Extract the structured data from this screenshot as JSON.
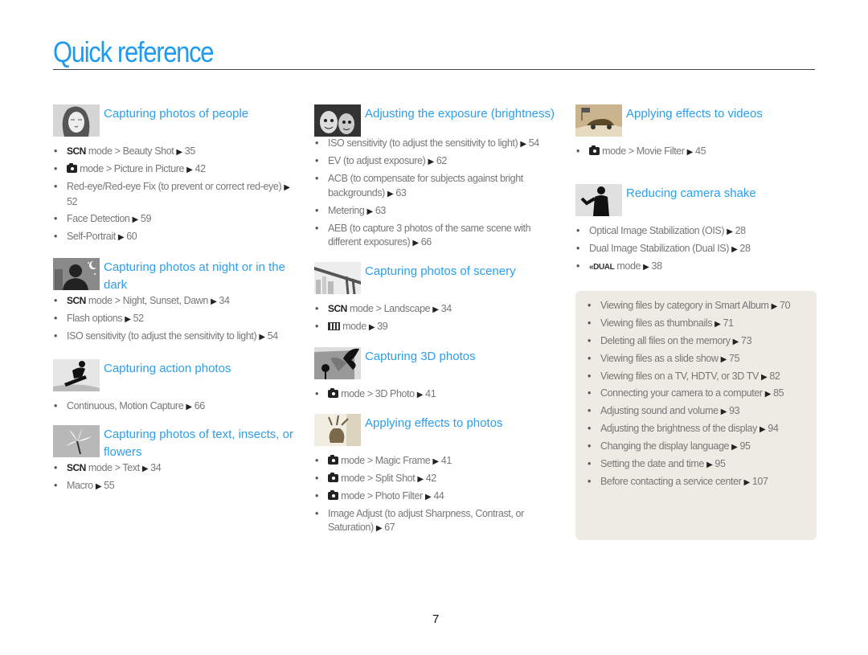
{
  "page": {
    "title": "Quick reference",
    "page_number": "7"
  },
  "columns": [
    {
      "sections": [
        {
          "title": "Capturing photos of people",
          "icon": "portrait-woman-thumbnail",
          "items": [
            {
              "prefix": "SCN",
              "text": " mode > Beauty Shot ",
              "page": "35"
            },
            {
              "prefix": "smart-auto-camera-icon",
              "text": " mode > Picture in Picture ",
              "page": "42"
            },
            {
              "prefix": "",
              "text": "Red-eye/Red-eye Fix (to prevent or correct red-eye) ",
              "page": "52"
            },
            {
              "prefix": "",
              "text": "Face Detection ",
              "page": "59"
            },
            {
              "prefix": "",
              "text": "Self-Portrait ",
              "page": "60"
            }
          ]
        },
        {
          "title": "Capturing photos at night or in the dark",
          "icon": "night-silhouette-thumbnail",
          "items": [
            {
              "prefix": "SCN",
              "text": " mode > Night, Sunset, Dawn ",
              "page": "34"
            },
            {
              "prefix": "",
              "text": "Flash options ",
              "page": "52"
            },
            {
              "prefix": "",
              "text": "ISO sensitivity (to adjust the sensitivity to light) ",
              "page": "54"
            }
          ]
        },
        {
          "title": "Capturing action photos",
          "icon": "snowboarder-thumbnail",
          "items": [
            {
              "prefix": "",
              "text": "Continuous, Motion Capture ",
              "page": "66"
            }
          ]
        },
        {
          "title": "Capturing photos of text, insects, or flowers",
          "icon": "flower-thumbnail",
          "items": [
            {
              "prefix": "SCN",
              "text": " mode > Text ",
              "page": "34"
            },
            {
              "prefix": "",
              "text": "Macro ",
              "page": "55"
            }
          ]
        }
      ]
    },
    {
      "sections": [
        {
          "title": "Adjusting the exposure (brightness)",
          "icon": "couple-faces-thumbnail",
          "items": [
            {
              "prefix": "",
              "text": "ISO sensitivity (to adjust the sensitivity to light) ",
              "page": "54"
            },
            {
              "prefix": "",
              "text": "EV (to adjust exposure) ",
              "page": "62"
            },
            {
              "prefix": "",
              "text": "ACB (to compensate for subjects against bright backgrounds) ",
              "page": "63"
            },
            {
              "prefix": "",
              "text": "Metering ",
              "page": "63"
            },
            {
              "prefix": "",
              "text": "AEB (to capture 3 photos of the same scene with different exposures) ",
              "page": "66"
            }
          ]
        },
        {
          "title": "Capturing photos of scenery",
          "icon": "bridge-thumbnail",
          "items": [
            {
              "prefix": "SCN",
              "text": " mode > Landscape ",
              "page": "34"
            },
            {
              "prefix": "panorama-icon",
              "text": " mode ",
              "page": "39"
            }
          ]
        },
        {
          "title": "Capturing 3D photos",
          "icon": "butterfly-3d-thumbnail",
          "items": [
            {
              "prefix": "smart-auto-camera-icon",
              "text": " mode > 3D Photo ",
              "page": "41"
            }
          ]
        },
        {
          "title": "Applying effects to photos",
          "icon": "vase-thumbnail",
          "items": [
            {
              "prefix": "smart-auto-camera-icon",
              "text": " mode > Magic Frame ",
              "page": "41"
            },
            {
              "prefix": "smart-auto-camera-icon",
              "text": " mode > Split Shot ",
              "page": "42"
            },
            {
              "prefix": "smart-auto-camera-icon",
              "text": " mode > Photo Filter ",
              "page": "44"
            },
            {
              "prefix": "",
              "text": "Image Adjust (to adjust Sharpness, Contrast, or Saturation) ",
              "page": "67"
            }
          ]
        }
      ]
    },
    {
      "sections": [
        {
          "title": "Applying effects to videos",
          "icon": "race-car-thumbnail",
          "items": [
            {
              "prefix": "smart-auto-camera-icon",
              "text": " mode > Movie Filter ",
              "page": "45"
            }
          ]
        },
        {
          "title": "Reducing camera shake",
          "icon": "man-silhouette-thumbnail",
          "items": [
            {
              "prefix": "",
              "text": "Optical Image Stabilization (OIS) ",
              "page": "28"
            },
            {
              "prefix": "",
              "text": "Dual Image Stabilization (Dual IS) ",
              "page": "28"
            },
            {
              "prefix": "DUAL",
              "text": " mode ",
              "page": "38"
            }
          ]
        }
      ]
    }
  ],
  "help_box": {
    "items": [
      {
        "text": "Viewing files by category in Smart Album ",
        "page": "70"
      },
      {
        "text": "Viewing files as thumbnails ",
        "page": "71"
      },
      {
        "text": "Deleting all files on the memory ",
        "page": "73"
      },
      {
        "text": "Viewing files as a slide show ",
        "page": "75"
      },
      {
        "text": "Viewing files on a TV, HDTV, or 3D TV ",
        "page": "82"
      },
      {
        "text": "Connecting your camera to a computer ",
        "page": "85"
      },
      {
        "text": "Adjusting sound and volume ",
        "page": "93"
      },
      {
        "text": "Adjusting the brightness of the display ",
        "page": "94"
      },
      {
        "text": "Changing the display language ",
        "page": "95"
      },
      {
        "text": "Setting the date and time ",
        "page": "95"
      },
      {
        "text": "Before contacting a service center ",
        "page": "107"
      }
    ]
  },
  "symbols": {
    "arrow": "▶",
    "scn": "SCN",
    "dual": "DUAL"
  }
}
